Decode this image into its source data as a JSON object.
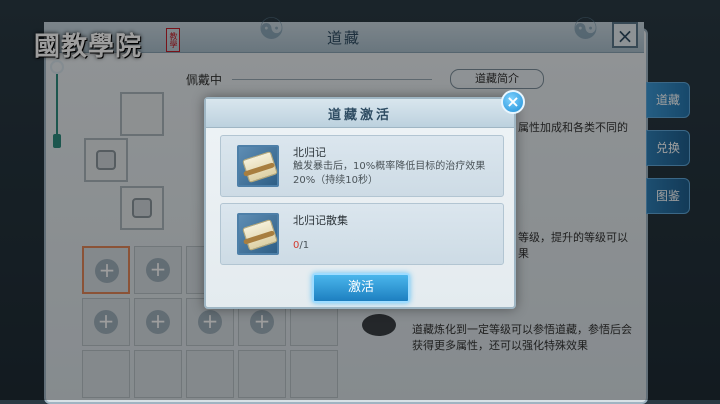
{
  "logo": {
    "text": "國教學院",
    "seal": "教學"
  },
  "background": {
    "title": "道藏",
    "equipped_label": "佩戴中",
    "intro_label": "道藏简介",
    "side_tabs": [
      "道藏",
      "兑换",
      "图鉴"
    ],
    "partial_texts": {
      "line1": "属性加成和各类不同的",
      "line2": "等级，提升的等级可以",
      "line3": "果"
    },
    "bottom_desc": "道藏炼化到一定等级可以参悟道藏，参悟后会获得更多属性，还可以强化特殊效果",
    "close": "×"
  },
  "modal": {
    "title": "道藏激活",
    "close": "×",
    "items": [
      {
        "name": "北归记",
        "description": "触发暴击后，10%概率降低目标的治疗效果20%（持续10秒）"
      },
      {
        "name": "北归记散集",
        "count_have": "0",
        "count_total": "/1"
      }
    ],
    "activate_label": "激活"
  }
}
